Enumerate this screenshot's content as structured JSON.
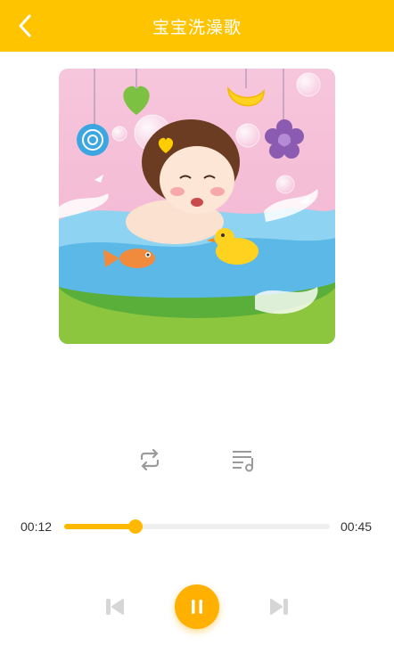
{
  "header": {
    "title": "宝宝洗澡歌",
    "back_icon": "chevron-left-icon",
    "background": "#FFC400"
  },
  "cover": {
    "icon": "album-art-illustration"
  },
  "modes": {
    "repeat_icon": "repeat-icon",
    "playlist_icon": "playlist-icon"
  },
  "progress": {
    "current": "00:12",
    "total": "00:45",
    "fraction": 0.27,
    "color": "#FFB800"
  },
  "controls": {
    "prev_icon": "skip-previous-icon",
    "pause_icon": "pause-icon",
    "next_icon": "skip-next-icon"
  }
}
